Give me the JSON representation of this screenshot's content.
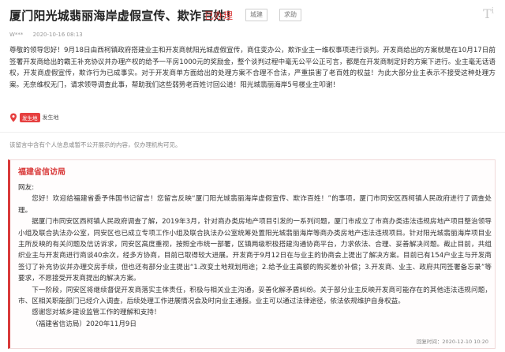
{
  "header": {
    "title": "厦门阳光城翡丽海岸虚假宣传、欺诈百姓！",
    "status": "已办理",
    "tags": [
      "城建",
      "求助"
    ],
    "logo": "T"
  },
  "meta": {
    "author": "W***",
    "datetime": "2020-10-16 08:13"
  },
  "message": {
    "body": "尊敬的领导您好！9月18日由西柯镇政府搭建业主和开发商就阳光城虚假宣传，商住变办公，欺诈业主一维权事项进行谈判。开发商给出的方案就是在10月17日前签署开发商给出的霸王补充协议并办理产权的给予一平房1000元的奖励金，整个谈判过程中毫无公平公正可言，都是在开发商制定好的方案下进行。业主毫无话语权，开发商虚假宣传，欺诈行为已成事实。对于开发商单方面给出的处理方案不合理不合法，严重损害了老百姓的权益！为此大部分业主表示不接受这种处理方案。无奈维权无门，请求领导调查此事，帮助我们这些弱势老百姓讨回公道！阳光城翡丽海岸5号楼业主叩谢！"
  },
  "location": {
    "pill": "发生地",
    "text": "发生地"
  },
  "disclaimer": "该留言中含有个人信息或暂不公开展示的内容，仅办理机构可见。",
  "reply": {
    "org": "福建省信访局",
    "greeting": "网友:",
    "p1": "您好！欢迎给福建省委予伟国书记留言！您留言反映“厦门阳光城翡丽海岸虚假宣传、欺诈百姓！”的事项，厦门市同安区西柯镇人民政府进行了调查处理。",
    "p2": "据厦门市同安区西柯镇人民政府调查了解，2019年3月，针对商办类房地产项目引发的一系列问题，厦门市成立了市商办类违法违规房地产项目整治领导小组及联合执法办公室，同安区也已成立专项工作小组及联合执法办公室统筹处置阳光城翡丽海岸等商办类房地产违法违规项目。针对阳光城翡丽海岸项目业主所反映的有关问题及信访诉求，同安区高度重视，按照全市统一部署，区镇两级积极搭建沟通协商平台，力求依法、合理、妥善解决问题。截止目前，共组织业主与开发商进行商谈40余次，经多方协商，目前已取得较大进展。开发商于9月12日在与业主的协商会上提出了解决方案。目前已有154户业主与开发商签订了补充协议并办理交房手续，但也还有部分业主提出“1.改变土地规划用途；2.给予业主高额的购买差价补偿；3.开发商、业主、政府共同签署备忘录”等要求，不愿接受开发商提出的解决方案。",
    "p3": "下一阶段，同安区将继续督促开发商落实主体责任，积极与相关业主沟通，妥善化解矛盾纠纷。关于部分业主反映开发商可能存在的其他违法违规问题，市、区相关职能部门已经介入调查，后续处理工作进展情况会及时向业主通报。业主可以通过法律途径，依法依规维护自身权益。",
    "p4": "感谢您对城乡建设监管工作的理解和支持！",
    "signature": "（福建省信访局）2020年11月9日",
    "reply_time": "回复时间：2020-12-10 10:20"
  },
  "colors": {
    "accent": "#d93a3a",
    "muted": "#999999"
  }
}
